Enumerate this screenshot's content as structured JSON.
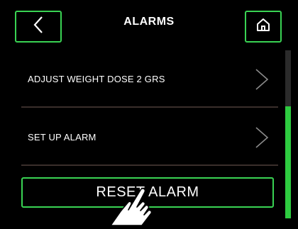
{
  "header": {
    "title": "ALARMS",
    "back_icon": "chevron-left-icon",
    "home_icon": "home-icon"
  },
  "menu": {
    "items": [
      {
        "label": "ADJUST WEIGHT DOSE 2 GRS",
        "icon": "chevron-right-icon"
      },
      {
        "label": "SET UP ALARM",
        "icon": "chevron-right-icon"
      }
    ]
  },
  "actions": {
    "reset_label": "RESET ALARM"
  },
  "scroll": {
    "position_fraction": 1.0
  },
  "colors": {
    "accent": "#39d353",
    "background": "#000000",
    "divider": "#3a2f2b",
    "scroll_thumb": "#2ecc40",
    "scroll_track": "#2b2b2b"
  }
}
